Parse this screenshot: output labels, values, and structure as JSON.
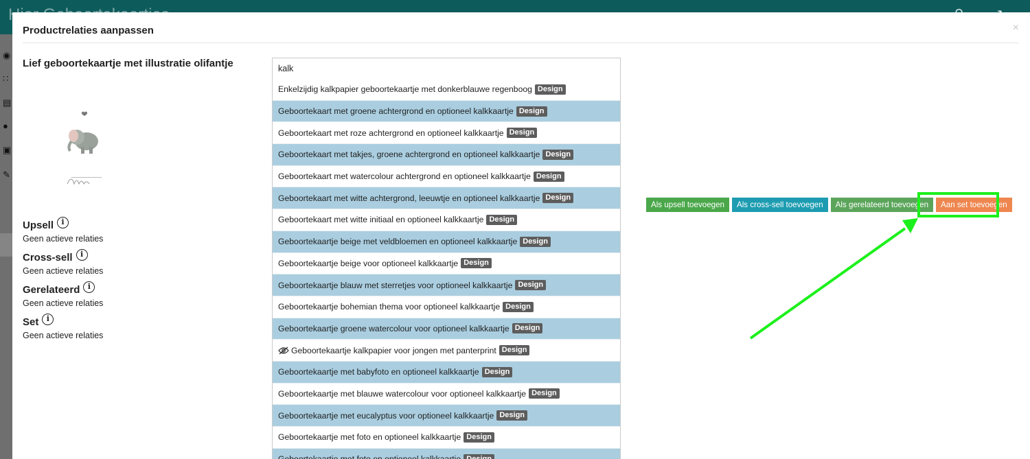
{
  "backdrop": {
    "brand_text": "Hier Geboortekaartjes"
  },
  "modal": {
    "title": "Productrelaties aanpassen",
    "close_label": "×",
    "product_name": "Lief geboortekaartje met illustratie olifantje",
    "relations": [
      {
        "title": "Upsell",
        "status": "Geen actieve relaties"
      },
      {
        "title": "Cross-sell",
        "status": "Geen actieve relaties"
      },
      {
        "title": "Gerelateerd",
        "status": "Geen actieve relaties"
      },
      {
        "title": "Set",
        "status": "Geen actieve relaties"
      }
    ],
    "info_glyph": "i",
    "search": {
      "value": "kalk",
      "placeholder": ""
    },
    "results": [
      {
        "label": "Enkelzijdig kalkpapier geboortekaartje met donkerblauwe regenboog",
        "badge": "Design",
        "hidden": false
      },
      {
        "label": "Geboortekaart met groene achtergrond en optioneel kalkkaartje",
        "badge": "Design",
        "hidden": false
      },
      {
        "label": "Geboortekaart met roze achtergrond en optioneel kalkkaartje",
        "badge": "Design",
        "hidden": false
      },
      {
        "label": "Geboortekaart met takjes, groene achtergrond en optioneel kalkkaartje",
        "badge": "Design",
        "hidden": false
      },
      {
        "label": "Geboortekaart met watercolour achtergrond en optioneel kalkkaartje",
        "badge": "Design",
        "hidden": false
      },
      {
        "label": "Geboortekaart met witte achtergrond, leeuwtje en optioneel kalkkaartje",
        "badge": "Design",
        "hidden": false
      },
      {
        "label": "Geboortekaart met witte initiaal en optioneel kalkkaartje",
        "badge": "Design",
        "hidden": false
      },
      {
        "label": "Geboortekaartje beige met veldbloemen en optioneel kalkkaartje",
        "badge": "Design",
        "hidden": false
      },
      {
        "label": "Geboortekaartje beige voor optioneel kalkkaartje",
        "badge": "Design",
        "hidden": false
      },
      {
        "label": "Geboortekaartje blauw met sterretjes voor optioneel kalkkaartje",
        "badge": "Design",
        "hidden": false
      },
      {
        "label": "Geboortekaartje bohemian thema voor optioneel kalkkaartje",
        "badge": "Design",
        "hidden": false
      },
      {
        "label": "Geboortekaartje groene watercolour voor optioneel kalkkaartje",
        "badge": "Design",
        "hidden": false
      },
      {
        "label": "Geboortekaartje kalkpapier voor jongen met panterprint",
        "badge": "Design",
        "hidden": true
      },
      {
        "label": "Geboortekaartje met babyfoto en optioneel kalkkaartje",
        "badge": "Design",
        "hidden": false
      },
      {
        "label": "Geboortekaartje met blauwe watercolour voor optioneel kalkkaartje",
        "badge": "Design",
        "hidden": false
      },
      {
        "label": "Geboortekaartje met eucalyptus voor optioneel kalkkaartje",
        "badge": "Design",
        "hidden": false
      },
      {
        "label": "Geboortekaartje met foto en optioneel kalkkaartje",
        "badge": "Design",
        "hidden": false
      },
      {
        "label": "Geboortekaartje met foto en optioneel kalkkaartje",
        "badge": "Design",
        "hidden": false
      }
    ],
    "actions": {
      "upsell": "Als upsell toevoegen",
      "cross_sell": "Als cross-sell toevoegen",
      "related": "Als gerelateerd toevoegen",
      "set": "Aan set toevoegen"
    }
  },
  "colors": {
    "highlight": "#1cf01c",
    "row_alt": "#aacee0",
    "btn_upsell": "#4aa74a",
    "btn_cross": "#1d9cb1",
    "btn_related": "#5ba55b",
    "btn_set": "#ee874f"
  }
}
